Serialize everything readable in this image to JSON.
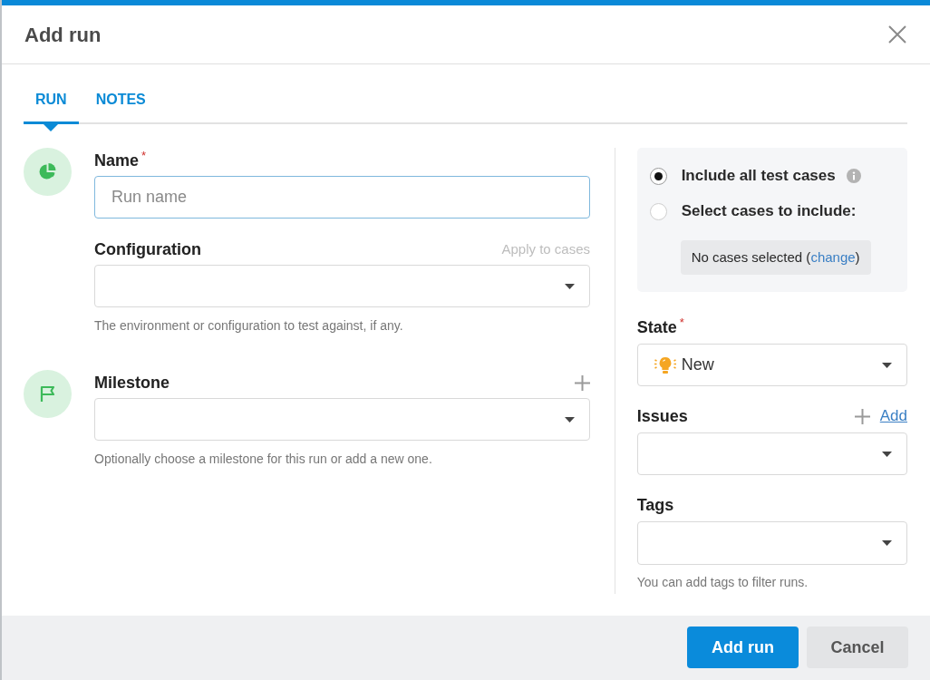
{
  "dialog": {
    "title": "Add run"
  },
  "tabs": [
    {
      "label": "RUN",
      "selected": true
    },
    {
      "label": "NOTES",
      "selected": false
    }
  ],
  "sections": [
    {
      "fields": [
        {
          "kind": "text",
          "label": "Name",
          "required_mark": "*",
          "placeholder": "Run name",
          "focused": true
        },
        {
          "kind": "select",
          "label": "Configuration",
          "action": {
            "label": "Apply to cases",
            "disabled": true
          },
          "help": "The environment or configuration to test against, if any."
        }
      ]
    },
    {
      "fields": [
        {
          "kind": "select",
          "label": "Milestone",
          "addable": true,
          "help": "Optionally choose a milestone for this run or add a new one."
        }
      ]
    }
  ],
  "case_selection": {
    "options": [
      {
        "label": "Include all test cases",
        "selected": true,
        "info": true
      },
      {
        "label": "Select cases to include:",
        "selected": false
      }
    ],
    "summary": {
      "before": "No cases selected (",
      "link": "change",
      "after": ")"
    }
  },
  "side_fields": [
    {
      "kind": "select",
      "label": "State",
      "required_mark": "*",
      "value": "New"
    },
    {
      "kind": "select",
      "label": "Issues",
      "addable": true,
      "add_link": "Add"
    },
    {
      "kind": "select",
      "label": "Tags",
      "help": "You can add tags to filter runs."
    }
  ],
  "buttons": [
    {
      "label": "Add run",
      "kind": "primary"
    },
    {
      "label": "Cancel",
      "kind": "secondary"
    }
  ]
}
